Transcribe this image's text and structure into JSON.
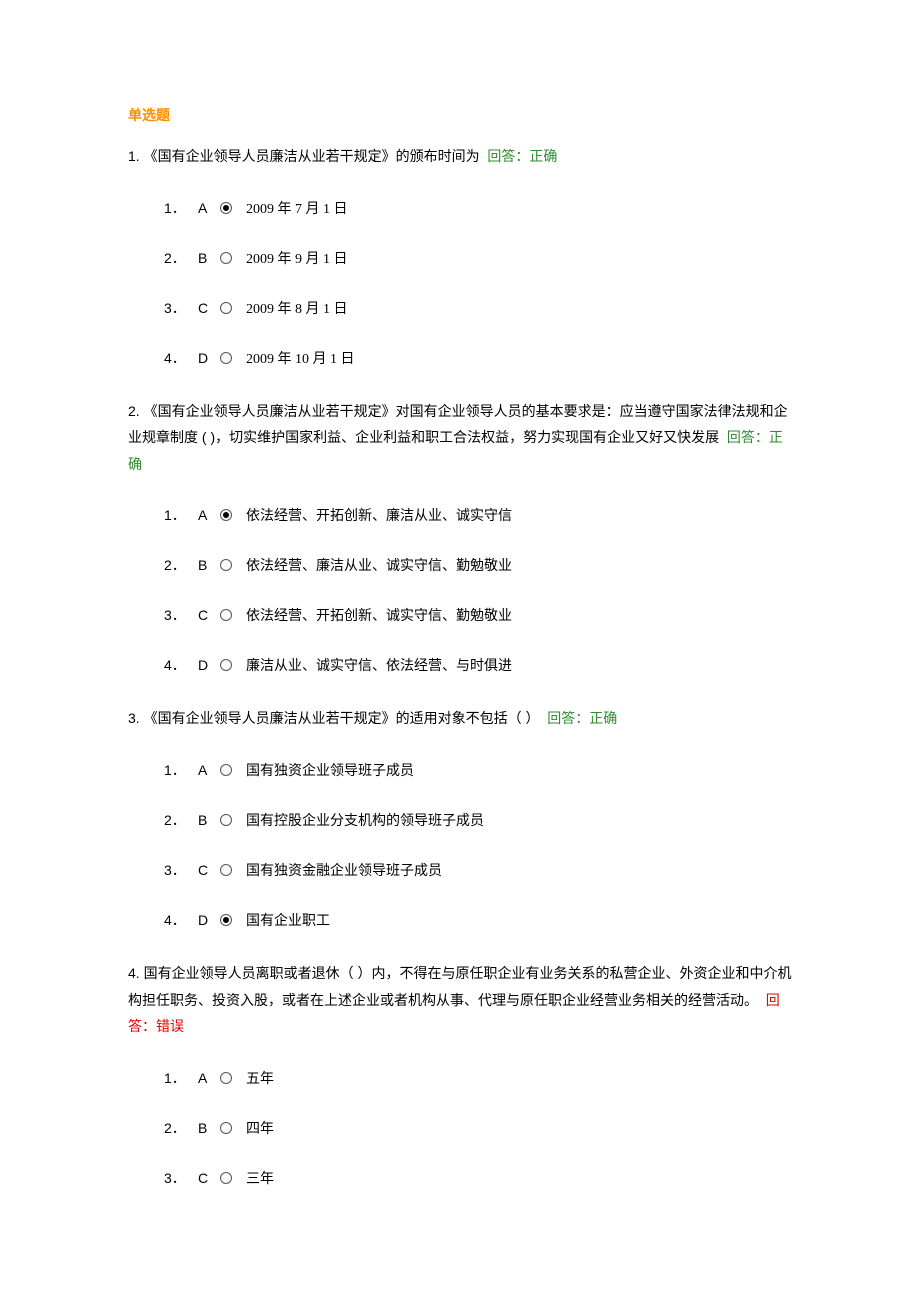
{
  "section_title": "单选题",
  "answer_label_correct": "回答：正确",
  "answer_label_wrong": "回答：错误",
  "questions": [
    {
      "num": "1.",
      "text": "《国有企业领导人员廉洁从业若干规定》的颁布时间为",
      "result": "correct",
      "options": [
        {
          "n": "1．",
          "letter": "A",
          "text": "2009 年 7 月 1 日",
          "selected": true
        },
        {
          "n": "2．",
          "letter": "B",
          "text": "2009 年 9 月 1 日",
          "selected": false
        },
        {
          "n": "3．",
          "letter": "C",
          "text": "2009 年 8 月 1 日",
          "selected": false
        },
        {
          "n": "4．",
          "letter": "D",
          "text": "2009 年 10 月 1 日",
          "selected": false
        }
      ]
    },
    {
      "num": "2.",
      "text": "《国有企业领导人员廉洁从业若干规定》对国有企业领导人员的基本要求是：应当遵守国家法律法规和企业规章制度 ( )，切实维护国家利益、企业利益和职工合法权益，努力实现国有企业又好又快发展",
      "result": "correct",
      "options": [
        {
          "n": "1．",
          "letter": "A",
          "text": "依法经营、开拓创新、廉洁从业、诚实守信",
          "selected": true
        },
        {
          "n": "2．",
          "letter": "B",
          "text": "依法经营、廉洁从业、诚实守信、勤勉敬业",
          "selected": false
        },
        {
          "n": "3．",
          "letter": "C",
          "text": "依法经营、开拓创新、诚实守信、勤勉敬业",
          "selected": false
        },
        {
          "n": "4．",
          "letter": "D",
          "text": "廉洁从业、诚实守信、依法经营、与时俱进",
          "selected": false
        }
      ]
    },
    {
      "num": "3.",
      "text": "《国有企业领导人员廉洁从业若干规定》的适用对象不包括（  ）",
      "result": "correct",
      "options": [
        {
          "n": "1．",
          "letter": "A",
          "text": "国有独资企业领导班子成员",
          "selected": false
        },
        {
          "n": "2．",
          "letter": "B",
          "text": "国有控股企业分支机构的领导班子成员",
          "selected": false
        },
        {
          "n": "3．",
          "letter": "C",
          "text": "国有独资金融企业领导班子成员",
          "selected": false
        },
        {
          "n": "4．",
          "letter": "D",
          "text": "国有企业职工",
          "selected": true
        }
      ]
    },
    {
      "num": "4.",
      "text": "国有企业领导人员离职或者退休（ ）内，不得在与原任职企业有业务关系的私营企业、外资企业和中介机构担任职务、投资入股，或者在上述企业或者机构从事、代理与原任职企业经营业务相关的经营活动。",
      "result": "wrong",
      "options": [
        {
          "n": "1．",
          "letter": "A",
          "text": "五年",
          "selected": false
        },
        {
          "n": "2．",
          "letter": "B",
          "text": "四年",
          "selected": false
        },
        {
          "n": "3．",
          "letter": "C",
          "text": "三年",
          "selected": false
        }
      ]
    }
  ]
}
